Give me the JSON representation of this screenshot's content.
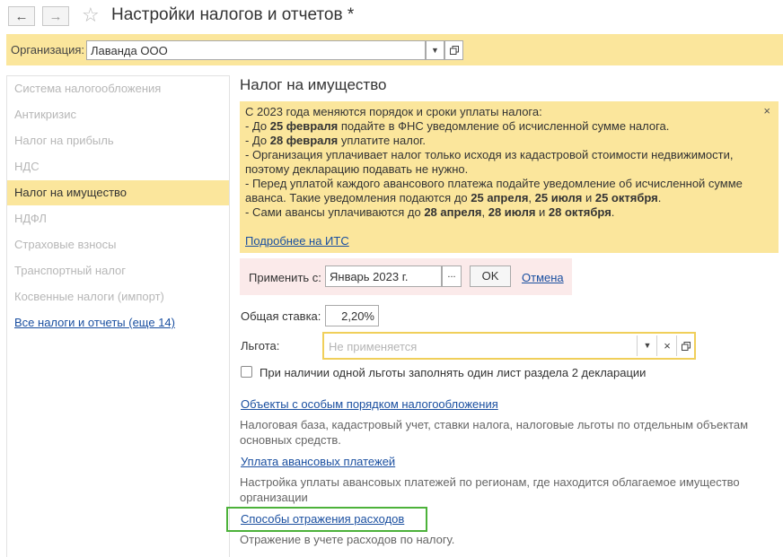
{
  "window": {
    "title": "Настройки налогов и отчетов *",
    "back_icon": "←",
    "forward_icon": "→",
    "star_icon": "☆"
  },
  "org": {
    "label": "Организация:",
    "value": "Лаванда ООО"
  },
  "sidebar": {
    "items": [
      {
        "label": "Система налогообложения"
      },
      {
        "label": "Антикризис"
      },
      {
        "label": "Налог на прибыль"
      },
      {
        "label": "НДС"
      },
      {
        "label": "Налог на имущество"
      },
      {
        "label": "НДФЛ"
      },
      {
        "label": "Страховые взносы"
      },
      {
        "label": "Транспортный налог"
      },
      {
        "label": "Косвенные налоги (импорт)"
      },
      {
        "label": "Все налоги и отчеты (еще 14)"
      }
    ]
  },
  "main": {
    "heading": "Налог на имущество",
    "info": {
      "l1": "С 2023 года меняются порядок и сроки уплаты налога:",
      "l2a": " - До ",
      "l2b": "25 февраля",
      "l2c": " подайте в ФНС уведомление об исчисленной сумме налога.",
      "l3a": " - До ",
      "l3b": "28 февраля",
      "l3c": " уплатите налог.",
      "l4": " - Организация уплачивает налог только исходя из кадастровой стоимости недвижимости,",
      "l5": "поэтому декларацию подавать не нужно.",
      "l6": " - Перед уплатой каждого авансового платежа подайте уведомление об исчисленной сумме",
      "l7a": "аванса. Такие уведомления подаются до ",
      "l7b": "25 апреля",
      "l7c": ", ",
      "l7d": "25 июля",
      "l7e": " и ",
      "l7f": "25 октября",
      "l7g": ".",
      "l8a": " - Сами авансы уплачиваются до ",
      "l8b": "28 апреля",
      "l8c": ", ",
      "l8d": "28 июля",
      "l8e": " и ",
      "l8f": "28 октября",
      "l8g": ".",
      "link": "Подробнее на ИТС",
      "close": "×"
    },
    "apply": {
      "label": "Применить с:",
      "value": "Январь 2023 г.",
      "dots": "...",
      "ok": "OK",
      "cancel": "Отмена"
    },
    "rate": {
      "label": "Общая ставка:",
      "value": "2,20%"
    },
    "benefit": {
      "label": "Льгота:",
      "placeholder": "Не применяется"
    },
    "checkbox_label": "При наличии одной льготы заполнять один лист раздела 2 декларации",
    "links": [
      {
        "title": "Объекты с особым порядком налогообложения",
        "desc1": "Налоговая база, кадастровый учет, ставки налога, налоговые льготы по отдельным объектам",
        "desc2": "основных средств."
      },
      {
        "title": "Уплата авансовых платежей",
        "desc1": "Настройка уплаты авансовых платежей по регионам, где находится облагаемое имущество",
        "desc2": "организации"
      },
      {
        "title": "Способы отражения расходов",
        "desc1": "Отражение в учете расходов по налогу.",
        "desc2": ""
      }
    ]
  },
  "colors": {
    "accent_yellow": "#fbe69c",
    "highlight_green": "#4cb23a",
    "link_blue": "#1a4fa0"
  }
}
